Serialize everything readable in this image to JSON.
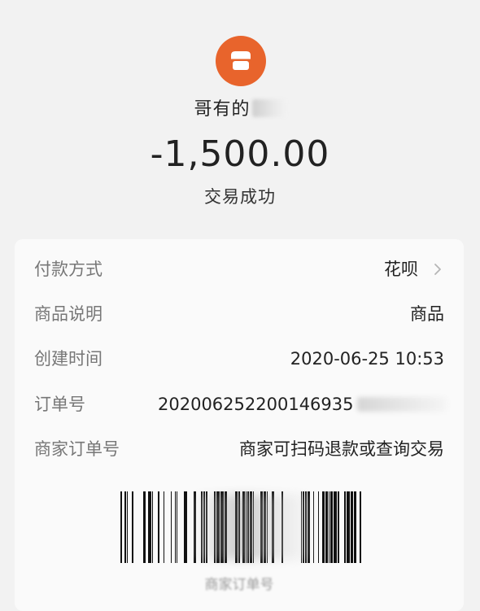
{
  "header": {
    "shop_icon": "store-icon",
    "merchant_name": "哥有的",
    "amount": "-1,500.00",
    "status": "交易成功"
  },
  "details": {
    "payment_method": {
      "label": "付款方式",
      "value": "花呗"
    },
    "product_desc": {
      "label": "商品说明",
      "value": "商品"
    },
    "created_time": {
      "label": "创建时间",
      "value": "2020-06-25 10:53"
    },
    "order_no": {
      "label": "订单号",
      "value": "20200625220014693​5"
    },
    "merchant_order_no": {
      "label": "商家订单号",
      "value": "商家可扫码退款或查询交易"
    }
  },
  "barcode": {
    "caption": "商家订单号"
  },
  "colors": {
    "accent": "#e8642c",
    "background": "#f2f2f2",
    "card": "#fafafa"
  }
}
